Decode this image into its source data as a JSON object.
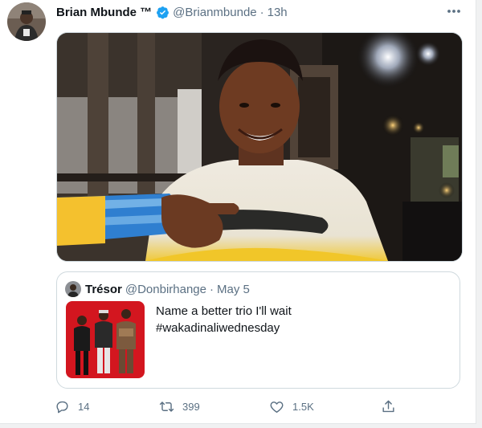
{
  "tweet": {
    "author_name": "Brian Mbunde ™",
    "handle": "@Brianmbunde",
    "separator": "·",
    "time": "13h"
  },
  "quote": {
    "author_name": "Trésor",
    "handle": "@Donbirhange",
    "separator": "·",
    "time": "May 5",
    "text_line1": "Name a better trio I'll wait",
    "text_line2": "#wakadinaliwednesday"
  },
  "actions": {
    "replies": "14",
    "retweets": "399",
    "likes": "1.5K"
  },
  "icons": {
    "verified": "verified-badge-icon",
    "more": "more-icon",
    "reply": "reply-icon",
    "retweet": "retweet-icon",
    "like": "heart-icon",
    "share": "share-icon"
  },
  "colors": {
    "verified_blue": "#1da1f2",
    "secondary_text": "#5b7083",
    "quote_media_bg": "#d3161f"
  }
}
